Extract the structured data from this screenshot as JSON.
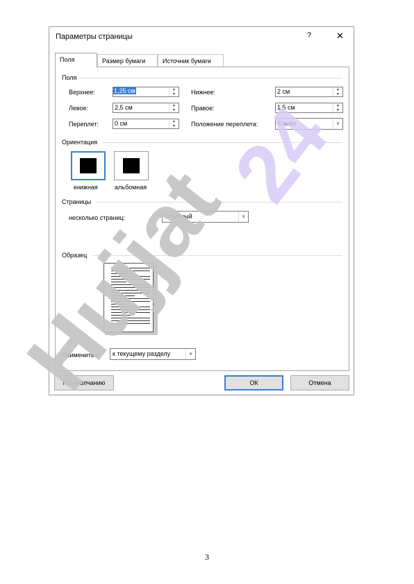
{
  "dialog": {
    "title": "Параметры страницы",
    "help_glyph": "?",
    "close_glyph": "✕",
    "tabs": [
      {
        "label": "Поля",
        "active": true
      },
      {
        "label": "Размер бумаги",
        "active": false
      },
      {
        "label": "Источник бумаги",
        "active": false
      }
    ],
    "margins": {
      "group_title": "Поля",
      "top_label": "Верхнее:",
      "top_value": "1,25 см",
      "bottom_label": "Нижнее:",
      "bottom_value": "2 см",
      "left_label": "Левое:",
      "left_value": "2,5 см",
      "right_label": "Правое:",
      "right_value": "1,5 см",
      "gutter_label": "Переплет:",
      "gutter_value": "0 см",
      "gutter_pos_label": "Положение переплета:",
      "gutter_pos_value": "Слева"
    },
    "orientation": {
      "group_title": "Ориентация",
      "portrait_label": "книжная",
      "landscape_label": "альбомная",
      "selected": "portrait"
    },
    "pages": {
      "group_title": "Страницы",
      "multiple_label": "несколько страниц:",
      "multiple_value": "Обычный"
    },
    "preview": {
      "group_title": "Образец"
    },
    "apply": {
      "label": "Применить к:",
      "value": "к текущему разделу"
    },
    "buttons": {
      "default_label": "По умолчанию",
      "ok_label": "ОК",
      "cancel_label": "Отмена"
    },
    "arrow_up_glyph": "▲",
    "arrow_down_glyph": "▼",
    "dropdown_glyph": "∨"
  },
  "watermarks": {
    "main": "Hujjat",
    "corner": "24"
  },
  "page_number": "3",
  "colors": {
    "accent": "#3d7fd1",
    "watermark_gray": "#c4c4c4",
    "watermark_purple": "#d8ccf8"
  }
}
